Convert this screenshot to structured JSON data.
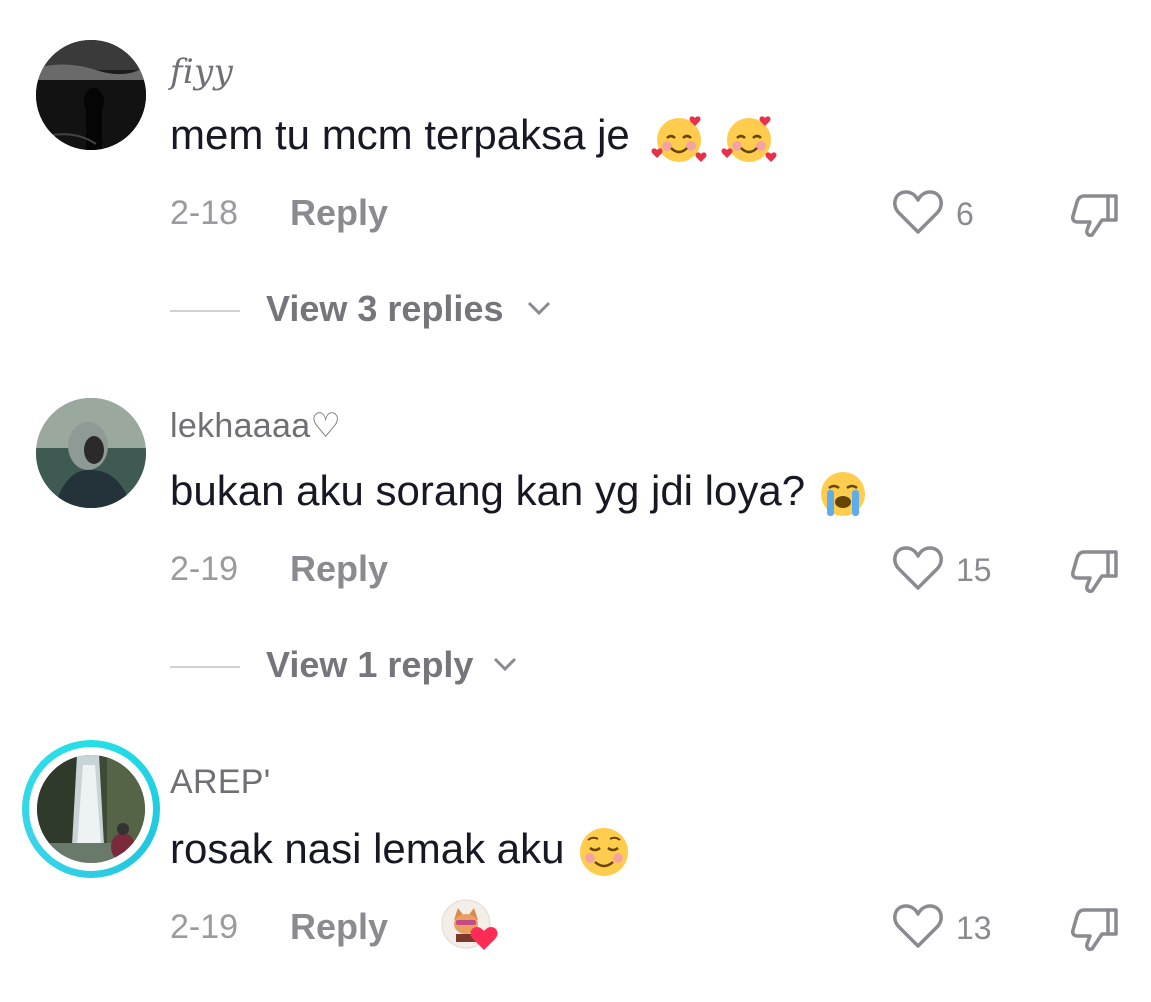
{
  "comments": [
    {
      "username": "fiyy",
      "text": "mem tu mcm terpaksa je",
      "emojis": [
        "smiling-face-with-hearts",
        "smiling-face-with-hearts"
      ],
      "date": "2-18",
      "reply_label": "Reply",
      "likes": "6",
      "view_replies": "View 3 replies"
    },
    {
      "username": "lekhaaaa♡",
      "text": "bukan aku sorang kan yg jdi loya?",
      "emojis": [
        "loudly-crying-face"
      ],
      "date": "2-19",
      "reply_label": "Reply",
      "likes": "15",
      "view_replies": "View 1 reply"
    },
    {
      "username": "AREP'",
      "text": "rosak nasi lemak aku",
      "emojis": [
        "smiling-face"
      ],
      "date": "2-19",
      "reply_label": "Reply",
      "likes": "13",
      "liked_by_creator": true
    }
  ],
  "colors": {
    "text": "#161823",
    "muted": "#8a8b91",
    "story_ring": "#24e0e6",
    "heart_red": "#fe2c55"
  }
}
